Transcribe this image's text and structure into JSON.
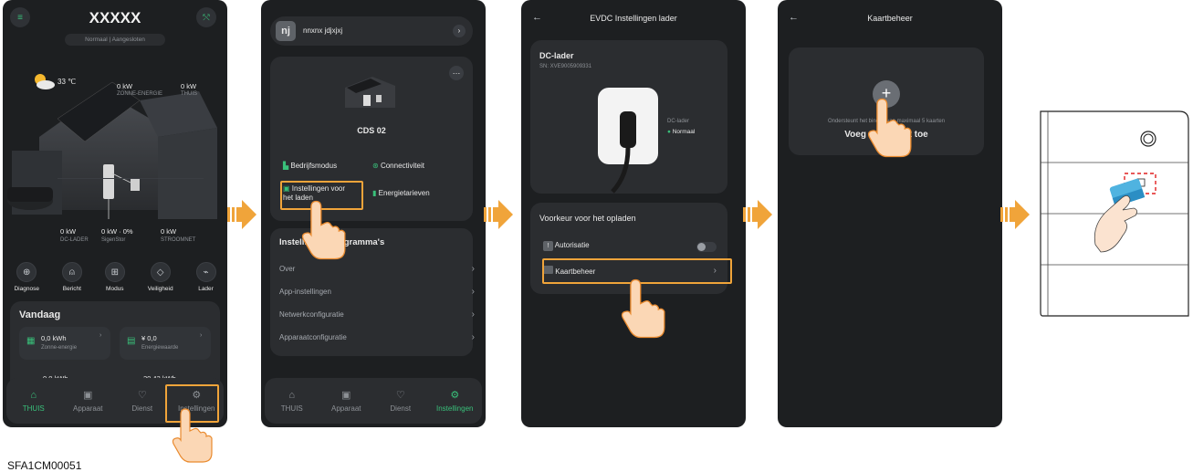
{
  "screen1": {
    "title": "XXXXX",
    "status": "Normaal | Aangesloten",
    "temperature": "33 ℃",
    "solar_value": "0 kW",
    "solar_label": "ZONNE-ENERGIE",
    "home_value": "0 kW",
    "home_label": "THUIS",
    "dc_value": "0 kW",
    "dc_label": "DC-LADER",
    "stor_value": "0 kW · 0%",
    "stor_label": "SigenStor",
    "grid_value": "0 kW",
    "grid_label": "STROOMNET",
    "quick_actions": [
      "Diagnose",
      "Bericht",
      "Modus",
      "Veiligheid",
      "Lader"
    ],
    "today_title": "Vandaag",
    "stat1_value": "0,0 kWh",
    "stat1_label": "Zonne-energie",
    "stat2_value": "¥ 0,0",
    "stat2_label": "Energiewaarde",
    "stat3_value": "0,0 kWh",
    "stat4_value": "20,43 kWh",
    "nav": [
      "THUIS",
      "Apparaat",
      "Dienst",
      "Instellingen"
    ]
  },
  "screen2": {
    "avatar": "nj",
    "username": "nnxnx jdjxjxj",
    "device_name": "CDS 02",
    "grid_items": [
      "Bedrijfsmodus",
      "Connectiviteit",
      "Instellingen voor het laden",
      "Energietarieven"
    ],
    "section_title": "Instellingen programma's",
    "list": [
      "Over",
      "App-instellingen",
      "Netwerkconfiguratie",
      "Apparaatconfiguratie"
    ],
    "nav": [
      "THUIS",
      "Apparaat",
      "Dienst",
      "Instellingen"
    ]
  },
  "screen3": {
    "title": "EVDC Instellingen lader",
    "charger_title": "DC-lader",
    "sn": "SN: XVE9005909331",
    "side_label": "DC-lader",
    "side_status": "Normaal",
    "section_title": "Voorkeur voor het opladen",
    "auth_label": "Autorisatie",
    "card_label": "Kaartbeheer"
  },
  "screen4": {
    "title": "Kaartbeheer",
    "hint": "Ondersteunt het binden van maximaal 5 kaarten",
    "add_label": "Voeg mijn kaart toe"
  },
  "caption": "SFA1CM00051",
  "colors": {
    "accent": "#39c07a",
    "highlight": "#f0a43a",
    "bg": "#1d1f21",
    "card": "#2b2d30"
  }
}
